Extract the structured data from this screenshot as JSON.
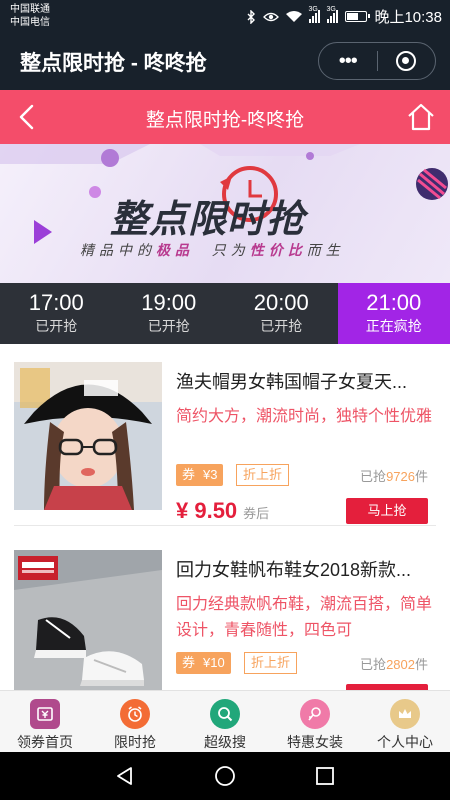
{
  "status_bar": {
    "carrier_1": "中国联通",
    "carrier_2": "中国电信",
    "time": "晚上10:38",
    "network_tag_1": "3G",
    "network_tag_2": "3G"
  },
  "mini_program": {
    "title": "整点限时抢 - 咚咚抢",
    "more_label": "•••"
  },
  "page_header": {
    "title": "整点限时抢-咚咚抢",
    "accent_color": "#f44d6a"
  },
  "banner": {
    "title": "整点限时抢",
    "subtitle_1": "精品中的",
    "subtitle_bold_1": "极品",
    "subtitle_2": "只为",
    "subtitle_bold_2": "性价比",
    "subtitle_3": "而生"
  },
  "time_tabs": [
    {
      "time": "17:00",
      "status": "已开抢"
    },
    {
      "time": "19:00",
      "status": "已开抢"
    },
    {
      "time": "20:00",
      "status": "已开抢"
    },
    {
      "time": "21:00",
      "status": "正在疯抢",
      "active": true
    }
  ],
  "products": [
    {
      "title": "渔夫帽男女韩国帽子女夏天...",
      "description": "简约大方，潮流时尚，独特个性优雅",
      "coupon_label": "券",
      "coupon_value": "¥3",
      "tag": "折上折",
      "sold_prefix": "已抢",
      "sold_count": "9726",
      "sold_suffix": "件",
      "price": "¥ 9.50",
      "price_note": "券后",
      "buy_label": "马上抢"
    },
    {
      "title": "回力女鞋帆布鞋女2018新款...",
      "description": "回力经典款帆布鞋，潮流百搭，简单设计，青春随性，四色可",
      "coupon_label": "券",
      "coupon_value": "¥10",
      "tag": "折上折",
      "sold_prefix": "已抢",
      "sold_count": "2802",
      "sold_suffix": "件",
      "price": "",
      "price_note": "",
      "buy_label": ""
    }
  ],
  "bottom_nav": [
    {
      "label": "领券首页",
      "icon": "coupon-icon",
      "color": "#b04a8c"
    },
    {
      "label": "限时抢",
      "icon": "alarm-clock-icon",
      "color": "#f36c35"
    },
    {
      "label": "超级搜",
      "icon": "search-icon",
      "color": "#21a77a"
    },
    {
      "label": "特惠女装",
      "icon": "dress-icon",
      "color": "#f07aa8"
    },
    {
      "label": "个人中心",
      "icon": "crown-icon",
      "color": "#e8b04a"
    }
  ]
}
